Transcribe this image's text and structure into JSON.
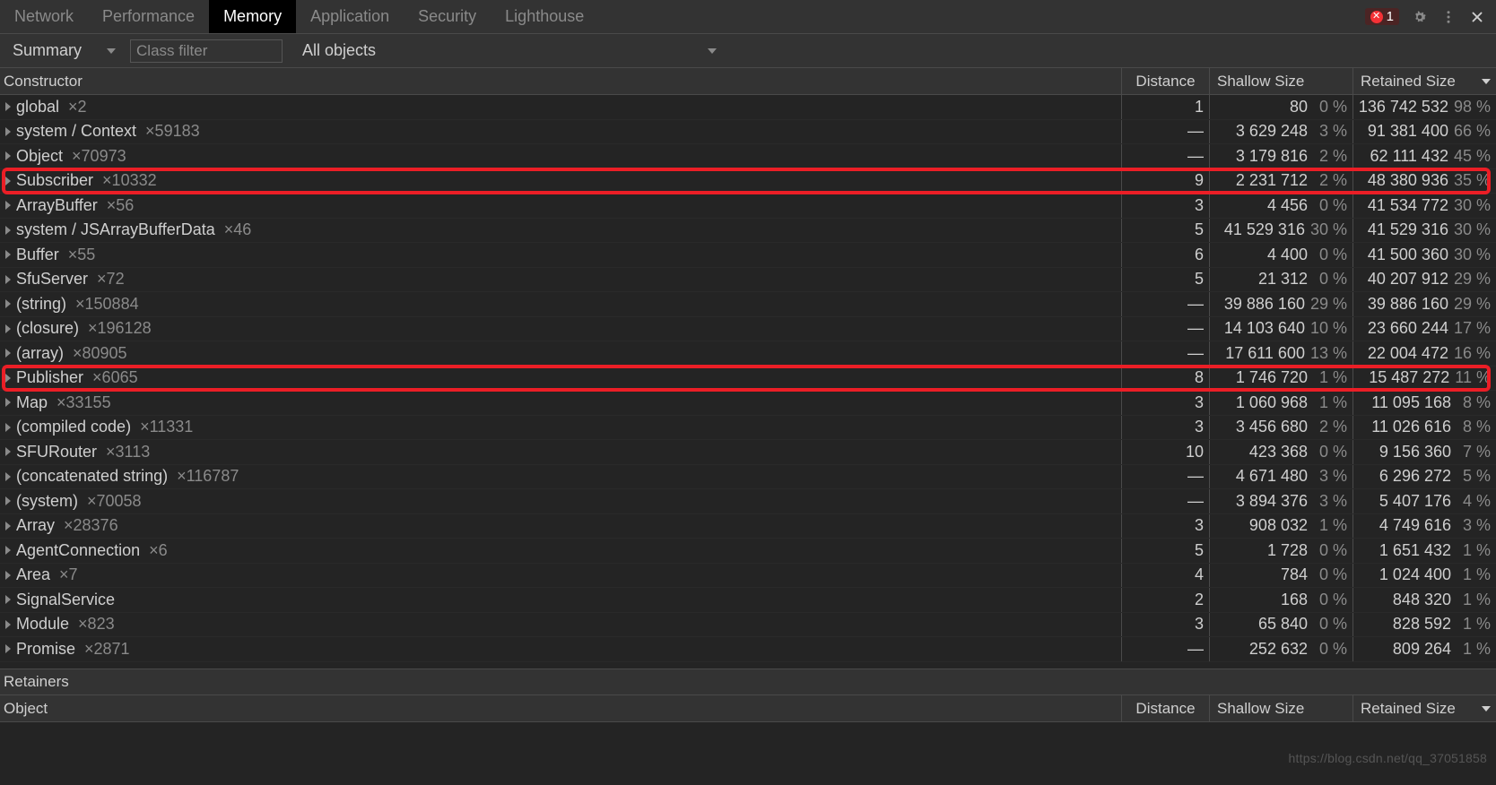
{
  "tabs": {
    "items": [
      "Network",
      "Performance",
      "Memory",
      "Application",
      "Security",
      "Lighthouse"
    ],
    "active_index": 2,
    "error_count": "1"
  },
  "toolbar": {
    "summary_label": "Summary",
    "class_filter_placeholder": "Class filter",
    "class_filter_value": "",
    "objects_label": "All objects"
  },
  "columns": {
    "constructor": "Constructor",
    "distance": "Distance",
    "shallow": "Shallow Size",
    "retained": "Retained Size"
  },
  "rows": [
    {
      "name": "global",
      "count": "×2",
      "distance": "1",
      "shallow": "80",
      "shallow_pct": "0 %",
      "retained": "136 742 532",
      "retained_pct": "98 %",
      "hl": false
    },
    {
      "name": "system / Context",
      "count": "×59183",
      "distance": "—",
      "shallow": "3 629 248",
      "shallow_pct": "3 %",
      "retained": "91 381 400",
      "retained_pct": "66 %",
      "hl": false
    },
    {
      "name": "Object",
      "count": "×70973",
      "distance": "—",
      "shallow": "3 179 816",
      "shallow_pct": "2 %",
      "retained": "62 111 432",
      "retained_pct": "45 %",
      "hl": false
    },
    {
      "name": "Subscriber",
      "count": "×10332",
      "distance": "9",
      "shallow": "2 231 712",
      "shallow_pct": "2 %",
      "retained": "48 380 936",
      "retained_pct": "35 %",
      "hl": true
    },
    {
      "name": "ArrayBuffer",
      "count": "×56",
      "distance": "3",
      "shallow": "4 456",
      "shallow_pct": "0 %",
      "retained": "41 534 772",
      "retained_pct": "30 %",
      "hl": false
    },
    {
      "name": "system / JSArrayBufferData",
      "count": "×46",
      "distance": "5",
      "shallow": "41 529 316",
      "shallow_pct": "30 %",
      "retained": "41 529 316",
      "retained_pct": "30 %",
      "hl": false
    },
    {
      "name": "Buffer",
      "count": "×55",
      "distance": "6",
      "shallow": "4 400",
      "shallow_pct": "0 %",
      "retained": "41 500 360",
      "retained_pct": "30 %",
      "hl": false
    },
    {
      "name": "SfuServer",
      "count": "×72",
      "distance": "5",
      "shallow": "21 312",
      "shallow_pct": "0 %",
      "retained": "40 207 912",
      "retained_pct": "29 %",
      "hl": false
    },
    {
      "name": "(string)",
      "count": "×150884",
      "distance": "—",
      "shallow": "39 886 160",
      "shallow_pct": "29 %",
      "retained": "39 886 160",
      "retained_pct": "29 %",
      "hl": false
    },
    {
      "name": "(closure)",
      "count": "×196128",
      "distance": "—",
      "shallow": "14 103 640",
      "shallow_pct": "10 %",
      "retained": "23 660 244",
      "retained_pct": "17 %",
      "hl": false
    },
    {
      "name": "(array)",
      "count": "×80905",
      "distance": "—",
      "shallow": "17 611 600",
      "shallow_pct": "13 %",
      "retained": "22 004 472",
      "retained_pct": "16 %",
      "hl": false
    },
    {
      "name": "Publisher",
      "count": "×6065",
      "distance": "8",
      "shallow": "1 746 720",
      "shallow_pct": "1 %",
      "retained": "15 487 272",
      "retained_pct": "11 %",
      "hl": true
    },
    {
      "name": "Map",
      "count": "×33155",
      "distance": "3",
      "shallow": "1 060 968",
      "shallow_pct": "1 %",
      "retained": "11 095 168",
      "retained_pct": "8 %",
      "hl": false
    },
    {
      "name": "(compiled code)",
      "count": "×11331",
      "distance": "3",
      "shallow": "3 456 680",
      "shallow_pct": "2 %",
      "retained": "11 026 616",
      "retained_pct": "8 %",
      "hl": false
    },
    {
      "name": "SFURouter",
      "count": "×3113",
      "distance": "10",
      "shallow": "423 368",
      "shallow_pct": "0 %",
      "retained": "9 156 360",
      "retained_pct": "7 %",
      "hl": false
    },
    {
      "name": "(concatenated string)",
      "count": "×116787",
      "distance": "—",
      "shallow": "4 671 480",
      "shallow_pct": "3 %",
      "retained": "6 296 272",
      "retained_pct": "5 %",
      "hl": false
    },
    {
      "name": "(system)",
      "count": "×70058",
      "distance": "—",
      "shallow": "3 894 376",
      "shallow_pct": "3 %",
      "retained": "5 407 176",
      "retained_pct": "4 %",
      "hl": false
    },
    {
      "name": "Array",
      "count": "×28376",
      "distance": "3",
      "shallow": "908 032",
      "shallow_pct": "1 %",
      "retained": "4 749 616",
      "retained_pct": "3 %",
      "hl": false
    },
    {
      "name": "AgentConnection",
      "count": "×6",
      "distance": "5",
      "shallow": "1 728",
      "shallow_pct": "0 %",
      "retained": "1 651 432",
      "retained_pct": "1 %",
      "hl": false
    },
    {
      "name": "Area",
      "count": "×7",
      "distance": "4",
      "shallow": "784",
      "shallow_pct": "0 %",
      "retained": "1 024 400",
      "retained_pct": "1 %",
      "hl": false
    },
    {
      "name": "SignalService",
      "count": "",
      "distance": "2",
      "shallow": "168",
      "shallow_pct": "0 %",
      "retained": "848 320",
      "retained_pct": "1 %",
      "hl": false
    },
    {
      "name": "Module",
      "count": "×823",
      "distance": "3",
      "shallow": "65 840",
      "shallow_pct": "0 %",
      "retained": "828 592",
      "retained_pct": "1 %",
      "hl": false
    },
    {
      "name": "Promise",
      "count": "×2871",
      "distance": "—",
      "shallow": "252 632",
      "shallow_pct": "0 %",
      "retained": "809 264",
      "retained_pct": "1 %",
      "hl": false
    }
  ],
  "footer": {
    "retainers": "Retainers",
    "object": "Object"
  },
  "watermark": "https://blog.csdn.net/qq_37051858"
}
